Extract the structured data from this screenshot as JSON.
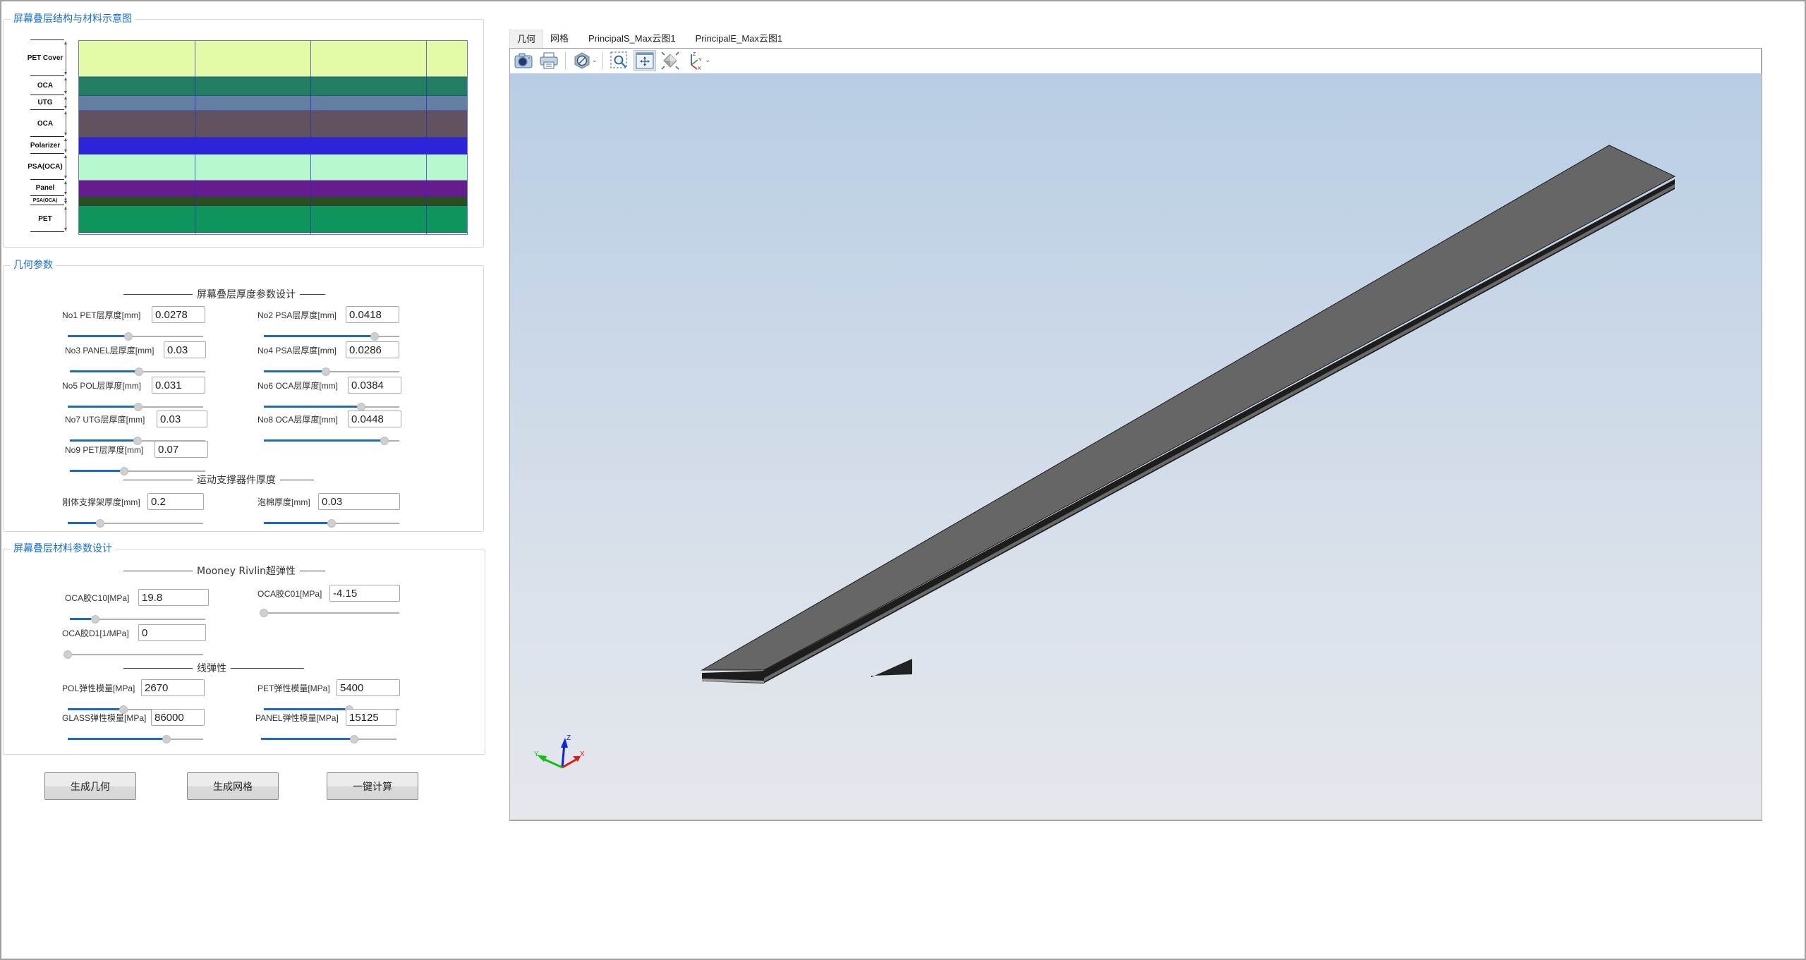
{
  "diagram": {
    "title": "屏幕叠层结构与材料示意图",
    "layers": [
      {
        "label": "PET Cover",
        "color": "#e3fba6",
        "small": false
      },
      {
        "label": "OCA",
        "color": "#237d60",
        "small": false
      },
      {
        "label": "UTG",
        "color": "#647fa4",
        "small": false
      },
      {
        "label": "OCA",
        "color": "#62525f",
        "small": false
      },
      {
        "label": "Polarizer",
        "color": "#2c24d9",
        "small": false
      },
      {
        "label": "PSA(OCA)",
        "color": "#b8f8cf",
        "small": false
      },
      {
        "label": "Panel",
        "color": "#661c8c",
        "small": false
      },
      {
        "label": "PSA(OCA)",
        "color": "#2a4e1e",
        "small": true
      },
      {
        "label": "PET",
        "color": "#0e955c",
        "small": false
      }
    ]
  },
  "geometry": {
    "title": "几何参数",
    "stack_section": "屏幕叠层厚度参数设计",
    "support_section": "运动支撑器件厚度",
    "params": [
      {
        "label": "No1 PET层厚度[mm]",
        "value": "0.0278",
        "slider": 0.45
      },
      {
        "label": "No2 PSA层厚度[mm]",
        "value": "0.0418",
        "slider": 0.82
      },
      {
        "label": "No3 PANEL层厚度[mm]",
        "value": "0.03",
        "slider": 0.51
      },
      {
        "label": "No4 PSA层厚度[mm]",
        "value": "0.0286",
        "slider": 0.46
      },
      {
        "label": "No5 POL层厚度[mm]",
        "value": "0.031",
        "slider": 0.52
      },
      {
        "label": "No6 OCA层厚度[mm]",
        "value": "0.0384",
        "slider": 0.72
      },
      {
        "label": "No7 UTG层厚度[mm]",
        "value": "0.03",
        "slider": 0.5
      },
      {
        "label": "No8 OCA层厚度[mm]",
        "value": "0.0448",
        "slider": 0.89
      },
      {
        "label": "No9 PET层厚度[mm]",
        "value": "0.07",
        "slider": 0.4
      }
    ],
    "support": [
      {
        "label": "刚体支撑架厚度[mm]",
        "value": "0.2",
        "slider": 0.24
      },
      {
        "label": "泡棉厚度[mm]",
        "value": "0.03",
        "slider": 0.5
      }
    ]
  },
  "material": {
    "title": "屏幕叠层材料参数设计",
    "mooney_section": "Mooney Rivlin超弹性",
    "linear_section": "线弹性",
    "mooney": [
      {
        "label": "OCA胶C10[MPa]",
        "value": "19.8",
        "slider": 0.19
      },
      {
        "label": "OCA胶C01[MPa]",
        "value": "-4.15",
        "slider": 0.0
      },
      {
        "label": "OCA胶D1[1/MPa]",
        "value": "0",
        "slider": 0.0
      }
    ],
    "linear": [
      {
        "label": "POL弹性模量[MPa]",
        "value": "2670",
        "slider": 0.41
      },
      {
        "label": "PET弹性模量[MPa]",
        "value": "5400",
        "slider": 0.63
      },
      {
        "label": "GLASS弹性模量[MPa]",
        "value": "86000",
        "slider": 0.73
      },
      {
        "label": "PANEL弹性模量[MPa]",
        "value": "15125",
        "slider": 0.69
      }
    ]
  },
  "buttons": {
    "generate_geometry": "生成几何",
    "generate_mesh": "生成网格",
    "one_click_compute": "一键计算"
  },
  "viewer": {
    "tabs": [
      "几何",
      "网格",
      "PrincipalS_Max云图1",
      "PrincipalE_Max云图1"
    ],
    "active_tab": 0,
    "toolbar": [
      "camera-icon",
      "print-icon",
      "display-style-icon",
      "zoom-box-icon",
      "fit-view-icon",
      "iso-view-icon",
      "axes-orientation-icon"
    ],
    "triad": {
      "x": "X",
      "y": "Y",
      "z": "Z"
    }
  }
}
